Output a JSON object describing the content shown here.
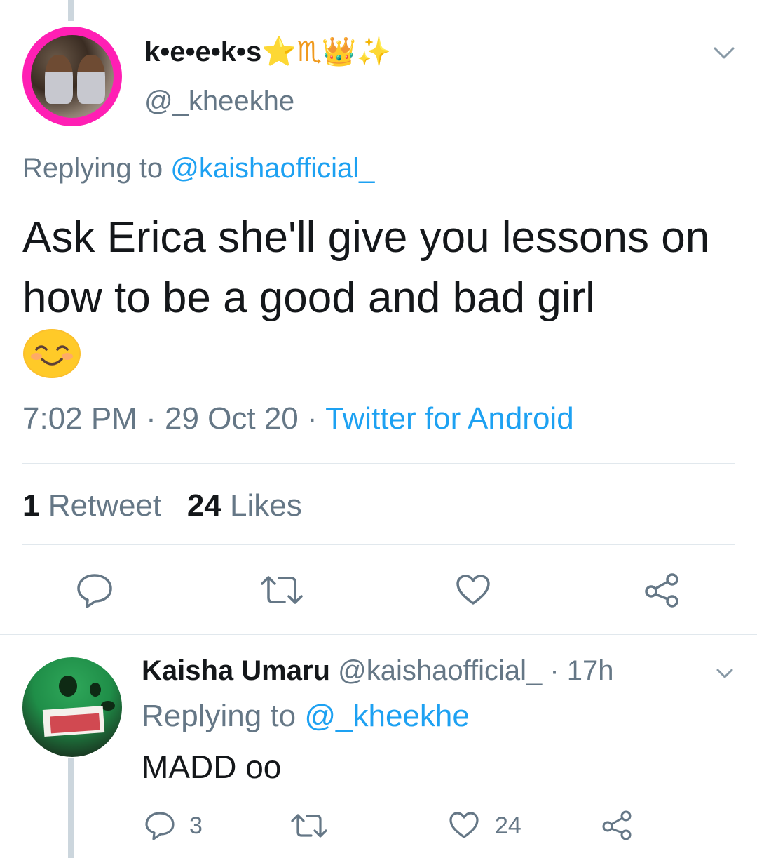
{
  "main_tweet": {
    "display_name": "k•e•e•k•s",
    "name_emojis": [
      "⭐",
      "♏",
      "👑",
      "✨"
    ],
    "handle": "@_kheekhe",
    "replying_prefix": "Replying to",
    "replying_to": "@kaishaofficial_",
    "text": "Ask Erica she'll give you lessons on how to be a good and bad girl",
    "emoji": "smiling-face-with-smiling-eyes",
    "time": "7:02 PM",
    "separator": " · ",
    "date": "29 Oct 20",
    "source": "Twitter for Android",
    "retweet_count": "1",
    "retweet_label": "Retweet",
    "like_count": "24",
    "like_label": "Likes",
    "avatar_ring_color": "#ff1fb4",
    "actions": [
      "reply-icon",
      "retweet-icon",
      "like-icon",
      "share-icon"
    ]
  },
  "reply_tweet": {
    "display_name": "Kaisha Umaru",
    "handle": "@kaishaofficial_",
    "time_separator": " · ",
    "age": "17h",
    "replying_prefix": "Replying to",
    "replying_to": "@_kheekhe",
    "text": "MADD oo",
    "reply_count": "3",
    "like_count": "24",
    "actions": [
      "reply-icon",
      "retweet-icon",
      "like-icon",
      "share-icon"
    ]
  },
  "colors": {
    "link": "#1da1f2",
    "secondary_text": "#657786",
    "primary_text": "#14171a",
    "divider": "#e1e8ed",
    "thread_line": "#ccd6dd"
  }
}
